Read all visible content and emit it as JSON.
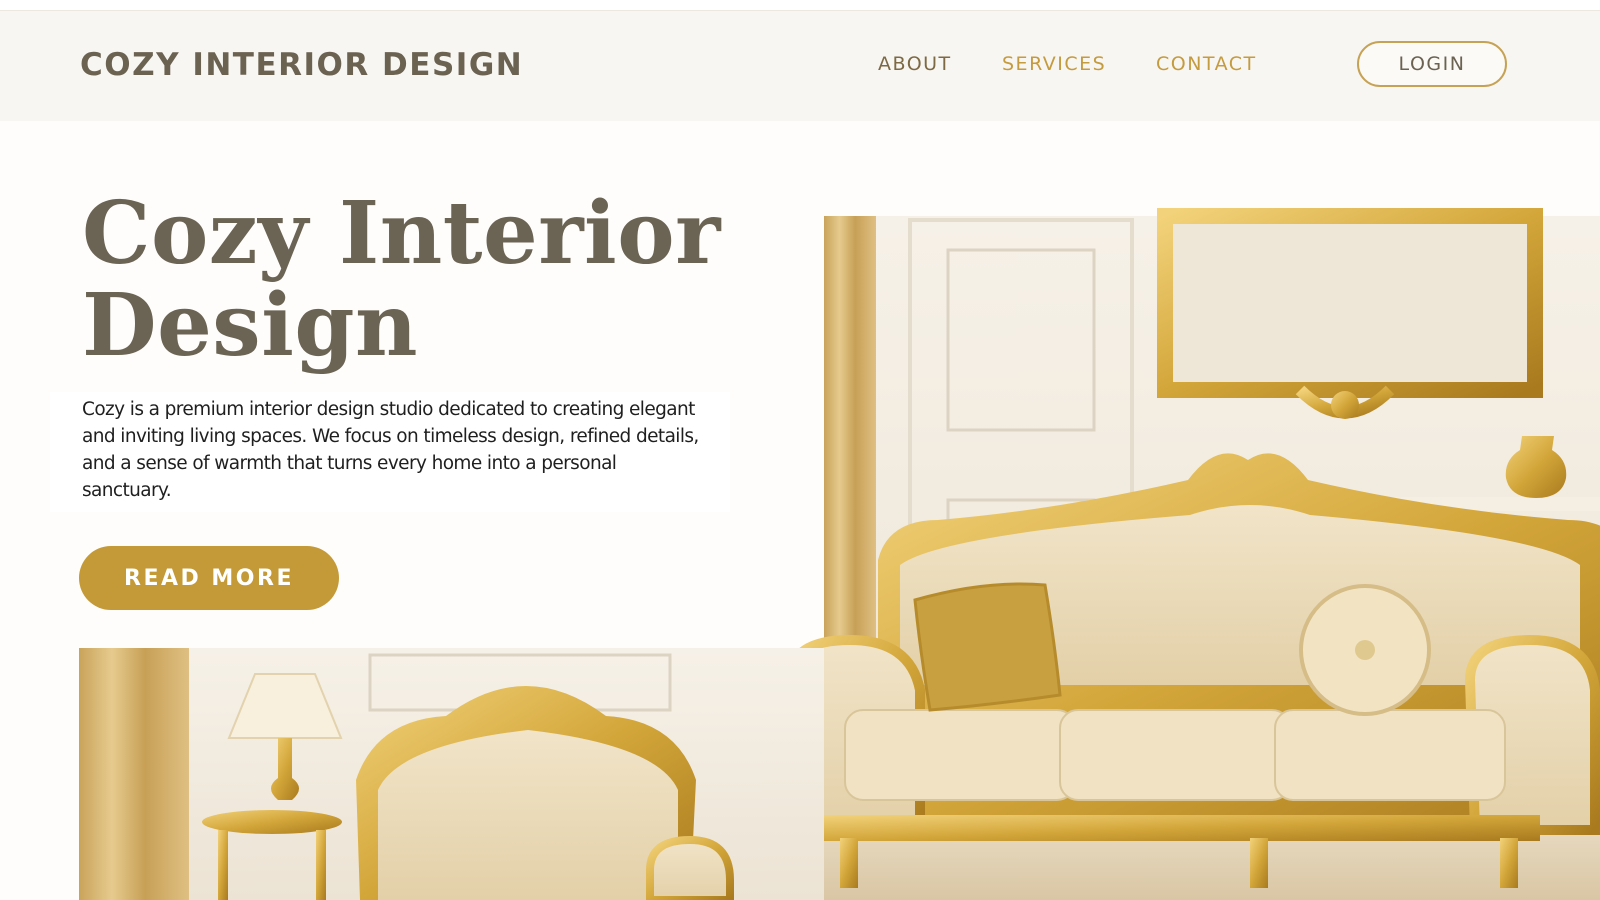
{
  "brand": "COZY INTERIOR DESIGN",
  "nav": {
    "about": "ABOUT",
    "services": "SERVICES",
    "contact": "CONTACT",
    "login": "LOGIN"
  },
  "hero": {
    "title_line1": "Cozy Interior",
    "title_line2": "Design",
    "description": "Cozy  is a premium interior design studio dedicated to creating elegant and inviting living spaces. We focus on timeless design, refined details, and a sense of warmth that turns every home into a personal sanctuary.",
    "button": "READ MORE"
  },
  "colors": {
    "accent_gold": "#c49a38",
    "title_taupe": "#6b6454",
    "nav_gold": "#c49b3e"
  }
}
